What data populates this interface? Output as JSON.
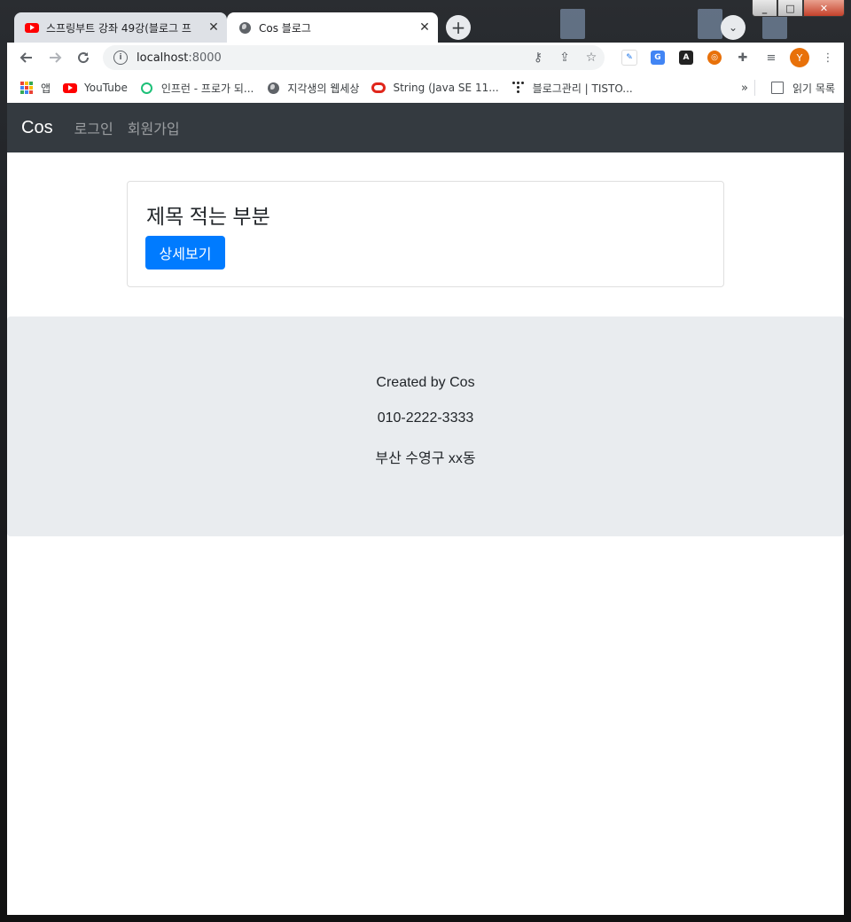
{
  "browser": {
    "tabs": [
      {
        "title": "스프링부트 강좌 49강(블로그 프",
        "active": false,
        "icon": "youtube-icon"
      },
      {
        "title": "Cos 블로그",
        "active": true,
        "icon": "globe-icon"
      }
    ],
    "new_tab_label": "+",
    "url_host": "localhost",
    "url_port": ":8000",
    "profile_initial": "Y",
    "bookmarks": [
      {
        "label": "앱",
        "icon": "apps-icon"
      },
      {
        "label": "YouTube",
        "icon": "youtube-icon"
      },
      {
        "label": "인프런 - 프로가 되...",
        "icon": "inflearn-icon"
      },
      {
        "label": "지각생의 웹세상",
        "icon": "globe-icon"
      },
      {
        "label": "String (Java SE 11...",
        "icon": "oracle-icon"
      },
      {
        "label": "블로그관리 | TISTO...",
        "icon": "tistory-icon"
      }
    ],
    "bookmarks_more": "»",
    "reading_list": "읽기 목록"
  },
  "navbar": {
    "brand": "Cos",
    "links": [
      "로그인",
      "회원가입"
    ]
  },
  "card": {
    "title": "제목 적는 부분",
    "button_label": "상세보기"
  },
  "footer": {
    "lines": [
      "Created by Cos",
      "010-2222-3333",
      "부산 수영구 xx동"
    ]
  },
  "colors": {
    "navbar_bg": "#343a40",
    "primary_button": "#007bff",
    "footer_bg": "#e9ecef"
  }
}
